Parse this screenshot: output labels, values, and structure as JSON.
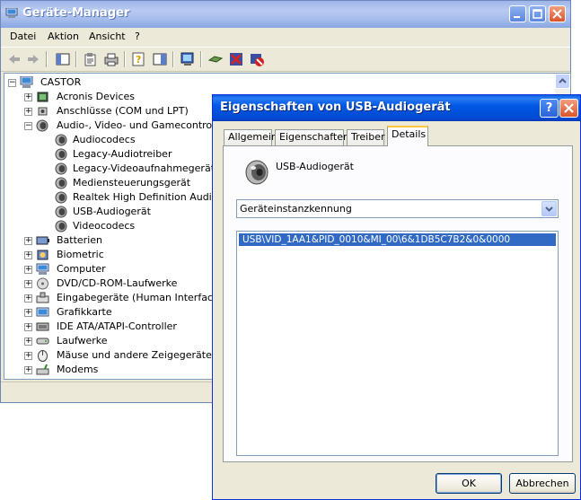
{
  "main_window": {
    "title": "Geräte-Manager",
    "menu": [
      "Datei",
      "Aktion",
      "Ansicht",
      "?"
    ],
    "toolbar_icons": [
      "back-arrow-icon",
      "forward-arrow-icon",
      "show-hide-tree-icon",
      "properties-icon",
      "print-icon",
      "help-icon",
      "action-pane-icon",
      "scan-hardware-icon",
      "update-driver-icon",
      "uninstall-icon",
      "disable-device-icon"
    ],
    "tree": {
      "root": "CASTOR",
      "items": [
        {
          "label": "Acronis Devices",
          "icon": "chip-icon",
          "expand": "+"
        },
        {
          "label": "Anschlüsse (COM und LPT)",
          "icon": "port-icon",
          "expand": "+"
        },
        {
          "label": "Audio-, Video- und Gamecontroller",
          "icon": "speaker-icon",
          "expand": "-",
          "children": [
            "Audiocodecs",
            "Legacy-Audiotreiber",
            "Legacy-Videoaufnahmegerät",
            "Mediensteuerungsgerät",
            "Realtek High Definition Audio",
            "USB-Audiogerät",
            "Videocodecs"
          ]
        },
        {
          "label": "Batterien",
          "icon": "battery-icon",
          "expand": "+"
        },
        {
          "label": "Biometric",
          "icon": "biometric-icon",
          "expand": "+"
        },
        {
          "label": "Computer",
          "icon": "computer-icon",
          "expand": "+"
        },
        {
          "label": "DVD/CD-ROM-Laufwerke",
          "icon": "cd-drive-icon",
          "expand": "+"
        },
        {
          "label": "Eingabegeräte (Human Interface De",
          "icon": "hid-icon",
          "expand": "+"
        },
        {
          "label": "Grafikkarte",
          "icon": "display-adapter-icon",
          "expand": "+"
        },
        {
          "label": "IDE ATA/ATAPI-Controller",
          "icon": "ide-controller-icon",
          "expand": "+"
        },
        {
          "label": "Laufwerke",
          "icon": "disk-drive-icon",
          "expand": "+"
        },
        {
          "label": "Mäuse und andere Zeigegeräte",
          "icon": "mouse-icon",
          "expand": "+"
        },
        {
          "label": "Modems",
          "icon": "modem-icon",
          "expand": "+"
        }
      ]
    }
  },
  "dialog": {
    "title": "Eigenschaften von USB-Audiogerät",
    "title_buttons": {
      "help": "?",
      "close": "✕"
    },
    "tabs": [
      "Allgemein",
      "Eigenschaften",
      "Treiber",
      "Details"
    ],
    "active_tab": "Details",
    "device_name": "USB-Audiogerät",
    "property_select": "Geräteinstanzkennung",
    "value": "USB\\VID_1AA1&PID_0010&MI_00\\6&1DB5C7B2&0&0000",
    "ok_label": "OK",
    "cancel_label": "Abbrechen"
  },
  "colors": {
    "inactive_title": "#9db5e8",
    "active_title": "#0058e6",
    "selection": "#316ac5",
    "window_face": "#ece9d8"
  }
}
